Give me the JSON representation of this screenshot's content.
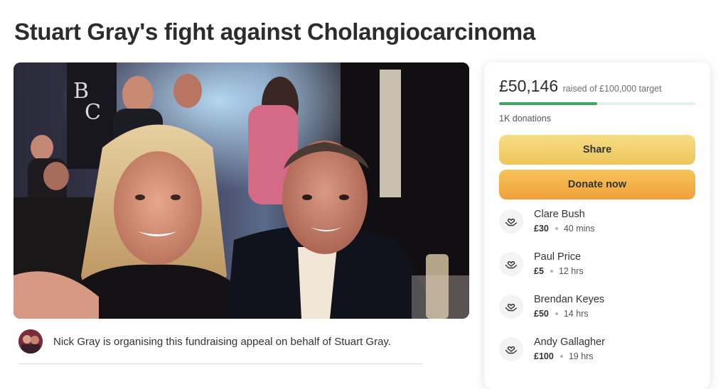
{
  "page_title": "Stuart Gray's fight against Cholangiocarcinoma",
  "organiser": {
    "text": "Nick Gray is organising this fundraising appeal on behalf of Stuart Gray."
  },
  "summary": {
    "raised_amount": "£50,146",
    "raised_text": "raised of £100,000 target",
    "progress_fraction": 0.5015,
    "donations_count": "1K donations"
  },
  "actions": {
    "share_label": "Share",
    "donate_label": "Donate now"
  },
  "donations": [
    {
      "name": "Clare Bush",
      "amount": "£30",
      "time": "40 mins"
    },
    {
      "name": "Paul Price",
      "amount": "£5",
      "time": "12 hrs"
    },
    {
      "name": "Brendan Keyes",
      "amount": "£50",
      "time": "14 hrs"
    },
    {
      "name": "Andy Gallagher",
      "amount": "£100",
      "time": "19 hrs"
    }
  ],
  "icons": {
    "donor": "heart-hands-icon"
  },
  "colors": {
    "progress": "#3ca85f",
    "share_button": "#f2d06c",
    "donate_button": "#f2b04a"
  }
}
